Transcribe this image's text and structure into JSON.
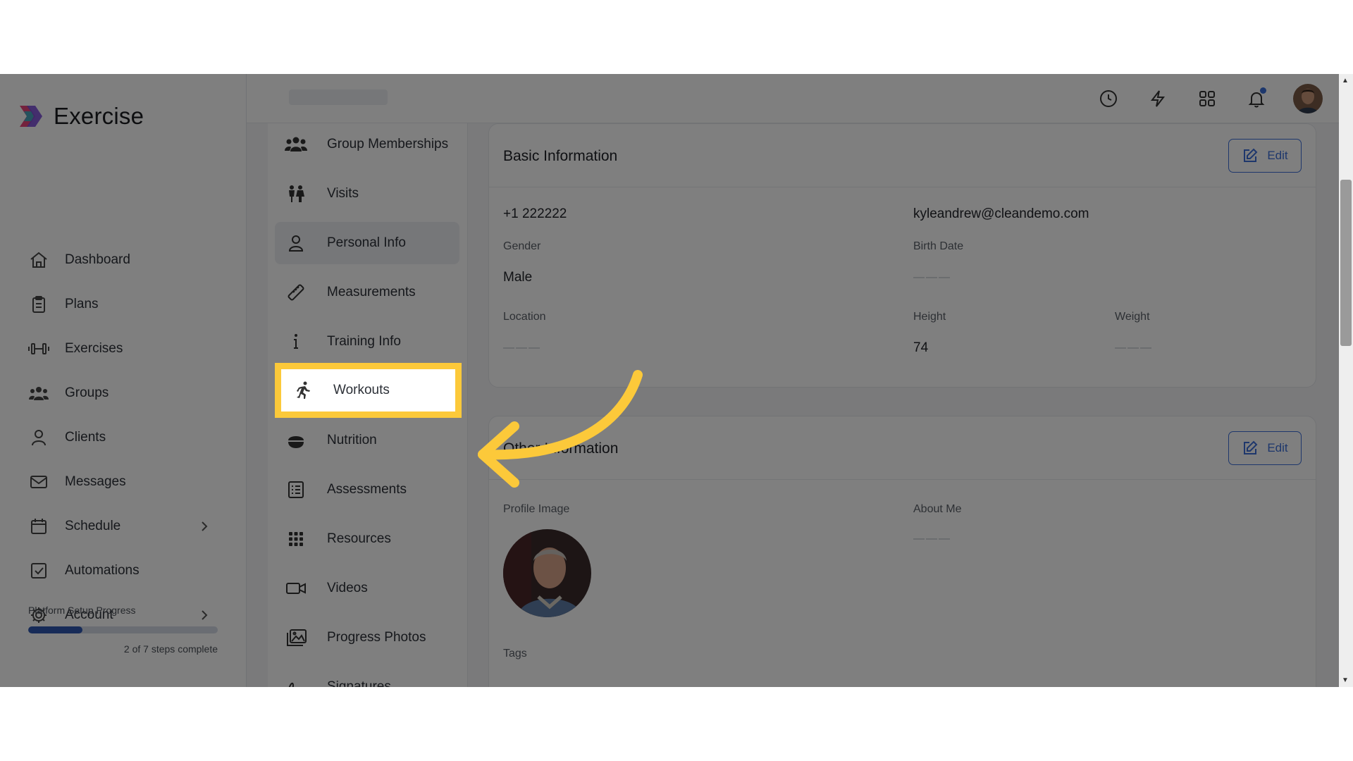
{
  "app": {
    "name": "Exercise",
    "logo_icon": "layered-chevron-logo-icon"
  },
  "sidebar": {
    "items": [
      {
        "label": "Dashboard",
        "icon": "home-icon"
      },
      {
        "label": "Plans",
        "icon": "clipboard-icon"
      },
      {
        "label": "Exercises",
        "icon": "dumbbell-icon"
      },
      {
        "label": "Groups",
        "icon": "users-icon"
      },
      {
        "label": "Clients",
        "icon": "user-icon"
      },
      {
        "label": "Messages",
        "icon": "mail-icon"
      },
      {
        "label": "Schedule",
        "icon": "calendar-icon",
        "has_submenu": true
      },
      {
        "label": "Automations",
        "icon": "checkbox-icon"
      },
      {
        "label": "Account",
        "icon": "gear-icon",
        "has_submenu": true
      }
    ],
    "setup": {
      "label": "Platform Setup Progress",
      "steps_text": "2 of 7 steps complete",
      "progress_fraction": 0.2857
    }
  },
  "topbar": {
    "icons": [
      "clock-icon",
      "lightning-icon",
      "apps-grid-icon",
      "bell-icon"
    ],
    "has_notification": true
  },
  "subnav": {
    "items": [
      {
        "label": "Group Memberships",
        "icon": "group-icon"
      },
      {
        "label": "Visits",
        "icon": "visitors-icon"
      },
      {
        "label": "Personal Info",
        "icon": "person-icon",
        "active": true
      },
      {
        "label": "Measurements",
        "icon": "ruler-icon"
      },
      {
        "label": "Training Info",
        "icon": "info-icon"
      },
      {
        "label": "Workouts",
        "icon": "running-icon",
        "highlighted": true
      },
      {
        "label": "Nutrition",
        "icon": "bowl-icon"
      },
      {
        "label": "Assessments",
        "icon": "checklist-icon"
      },
      {
        "label": "Resources",
        "icon": "grid-dots-icon"
      },
      {
        "label": "Videos",
        "icon": "video-icon"
      },
      {
        "label": "Progress Photos",
        "icon": "photos-icon"
      },
      {
        "label": "Signatures",
        "icon": "signature-icon"
      }
    ]
  },
  "basic_info": {
    "title": "Basic Information",
    "edit_label": "Edit",
    "phone": "+1 222222",
    "email": "kyleandrew@cleandemo.com",
    "gender_label": "Gender",
    "gender_value": "Male",
    "birth_label": "Birth Date",
    "birth_value": "———",
    "location_label": "Location",
    "location_value": "———",
    "height_label": "Height",
    "height_value": "74",
    "weight_label": "Weight",
    "weight_value": "———"
  },
  "other_info": {
    "title": "Other Information",
    "edit_label": "Edit",
    "profile_label": "Profile Image",
    "about_label": "About Me",
    "about_value": "———",
    "tags_label": "Tags"
  },
  "colors": {
    "accent": "#3c6fd8",
    "highlight": "#fcc93a",
    "progress": "#2f56b0"
  }
}
